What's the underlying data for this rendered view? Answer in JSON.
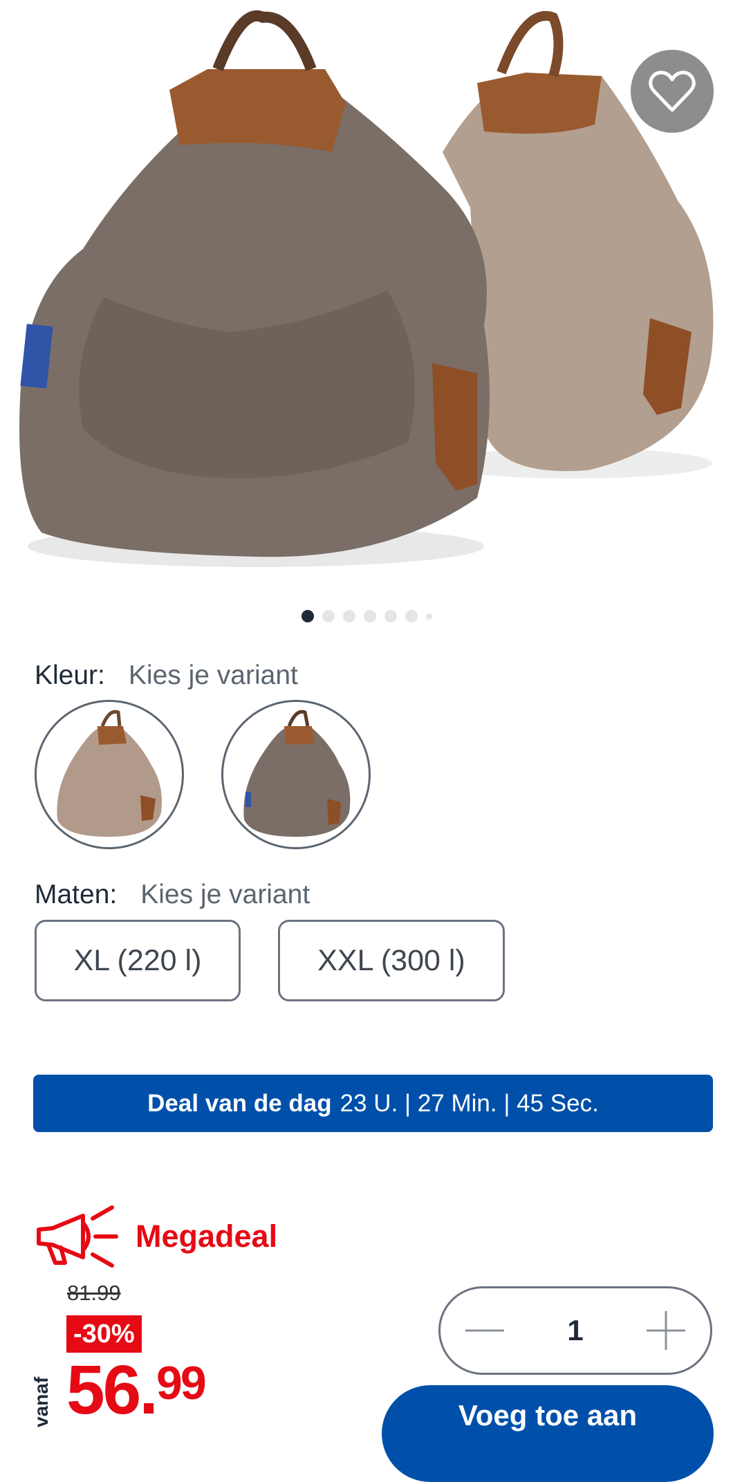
{
  "product": {
    "image_alt": "bean bag chairs",
    "favorite_icon": "heart-outline-icon",
    "carousel": {
      "count": 7,
      "active_index": 0
    }
  },
  "color": {
    "label": "Kleur:",
    "value": "Kies je variant",
    "options": [
      "beige",
      "taupe"
    ]
  },
  "sizes": {
    "label": "Maten:",
    "value": "Kies je variant",
    "options": [
      "XL (220 l)",
      "XXL (300 l)"
    ]
  },
  "deal_banner": {
    "title": "Deal van de dag",
    "timer": "23 U. | 27 Min. | 45 Sec."
  },
  "promo": {
    "icon": "megaphone-icon",
    "label": "Megadeal"
  },
  "price": {
    "old": "81.99",
    "discount": "-30%",
    "prefix": "vanaf",
    "main": "56.",
    "cents": "99"
  },
  "cart": {
    "quantity": "1",
    "add_label": "Voeg toe aan"
  },
  "colors": {
    "brand_blue": "#0050aa",
    "sale_red": "#e60a14"
  }
}
